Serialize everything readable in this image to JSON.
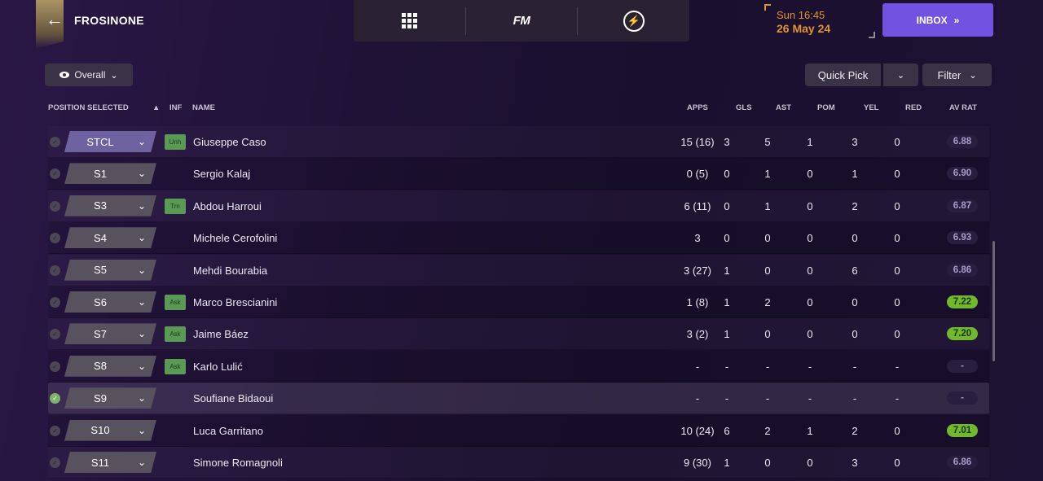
{
  "topbar": {
    "club_name": "FROSINONE",
    "back_icon": "arrow-left-icon",
    "center_icons": [
      "grid-icon",
      "fm-logo",
      "bolt-icon"
    ],
    "fm_label": "FM",
    "date_time": "Sun 16:45",
    "date_day": "26 May 24",
    "inbox_label": "INBOX",
    "inbox_icon": "double-chevron-right-icon",
    "colors": {
      "inbox": "#7252e0",
      "date": "#e0942a"
    }
  },
  "toolbar": {
    "view_label": "Overall",
    "quick_pick_label": "Quick Pick",
    "filter_label": "Filter"
  },
  "table": {
    "headers": {
      "position": "POSITION SELECTED",
      "sort": "▲",
      "inf": "INF",
      "name": "NAME",
      "apps": "APPS",
      "gls": "GLS",
      "ast": "AST",
      "pom": "POM",
      "yel": "YEL",
      "red": "RED",
      "avrat": "AV RAT"
    },
    "rows": [
      {
        "pos": "STCL",
        "inf": "Unh",
        "name": "Giuseppe Caso",
        "apps": "15 (16)",
        "gls": "3",
        "ast": "5",
        "pom": "1",
        "yel": "3",
        "red": "0",
        "avrat": "6.88",
        "rating_style": "normal",
        "checked": false
      },
      {
        "pos": "S1",
        "inf": "",
        "name": "Sergio Kalaj",
        "apps": "0 (5)",
        "gls": "0",
        "ast": "1",
        "pom": "0",
        "yel": "1",
        "red": "0",
        "avrat": "6.90",
        "rating_style": "normal",
        "checked": false
      },
      {
        "pos": "S3",
        "inf": "Trn",
        "name": "Abdou Harroui",
        "apps": "6 (11)",
        "gls": "0",
        "ast": "1",
        "pom": "0",
        "yel": "2",
        "red": "0",
        "avrat": "6.87",
        "rating_style": "normal",
        "checked": false
      },
      {
        "pos": "S4",
        "inf": "",
        "name": "Michele Cerofolini",
        "apps": "3",
        "gls": "0",
        "ast": "0",
        "pom": "0",
        "yel": "0",
        "red": "0",
        "avrat": "6.93",
        "rating_style": "normal",
        "checked": false
      },
      {
        "pos": "S5",
        "inf": "",
        "name": "Mehdi Bourabia",
        "apps": "3 (27)",
        "gls": "1",
        "ast": "0",
        "pom": "0",
        "yel": "6",
        "red": "0",
        "avrat": "6.86",
        "rating_style": "normal",
        "checked": false
      },
      {
        "pos": "S6",
        "inf": "Ask",
        "name": "Marco Brescianini",
        "apps": "1 (8)",
        "gls": "1",
        "ast": "2",
        "pom": "0",
        "yel": "0",
        "red": "0",
        "avrat": "7.22",
        "rating_style": "good",
        "checked": false
      },
      {
        "pos": "S7",
        "inf": "Ask",
        "name": "Jaime Báez",
        "apps": "3 (2)",
        "gls": "1",
        "ast": "0",
        "pom": "0",
        "yel": "0",
        "red": "0",
        "avrat": "7.20",
        "rating_style": "good",
        "checked": false
      },
      {
        "pos": "S8",
        "inf": "Ask",
        "name": "Karlo Lulić",
        "apps": "-",
        "gls": "-",
        "ast": "-",
        "pom": "-",
        "yel": "-",
        "red": "-",
        "avrat": "-",
        "rating_style": "none",
        "checked": false
      },
      {
        "pos": "S9",
        "inf": "",
        "name": "Soufiane Bidaoui",
        "apps": "-",
        "gls": "-",
        "ast": "-",
        "pom": "-",
        "yel": "-",
        "red": "-",
        "avrat": "-",
        "rating_style": "none",
        "checked": true
      },
      {
        "pos": "S10",
        "inf": "",
        "name": "Luca Garritano",
        "apps": "10 (24)",
        "gls": "6",
        "ast": "2",
        "pom": "1",
        "yel": "2",
        "red": "0",
        "avrat": "7.01",
        "rating_style": "good",
        "checked": false
      },
      {
        "pos": "S11",
        "inf": "",
        "name": "Simone Romagnoli",
        "apps": "9 (30)",
        "gls": "1",
        "ast": "0",
        "pom": "0",
        "yel": "3",
        "red": "0",
        "avrat": "6.86",
        "rating_style": "normal",
        "checked": false
      }
    ]
  }
}
